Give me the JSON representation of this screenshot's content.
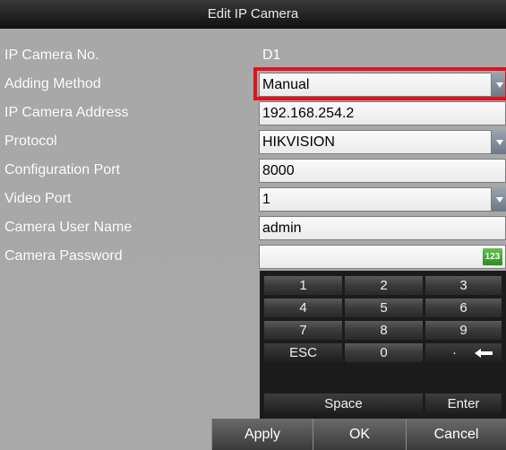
{
  "dialog": {
    "title": "Edit IP Camera"
  },
  "form": {
    "camera_no": {
      "label": "IP Camera No.",
      "value": "D1"
    },
    "adding_method": {
      "label": "Adding Method",
      "value": "Manual"
    },
    "camera_address": {
      "label": "IP Camera Address",
      "value": "192.168.254.2"
    },
    "protocol": {
      "label": "Protocol",
      "value": "HIKVISION"
    },
    "config_port": {
      "label": "Configuration Port",
      "value": "8000"
    },
    "video_port": {
      "label": "Video Port",
      "value": "1"
    },
    "user_name": {
      "label": "Camera User Name",
      "value": "admin"
    },
    "password": {
      "label": "Camera Password",
      "value": "",
      "mode_badge": "123"
    }
  },
  "keypad": {
    "keys": [
      "1",
      "2",
      "3",
      "4",
      "5",
      "6",
      "7",
      "8",
      "9"
    ],
    "esc": "ESC",
    "zero": "0",
    "dot": "·",
    "space": "Space",
    "enter": "Enter"
  },
  "buttons": {
    "apply": "Apply",
    "ok": "OK",
    "cancel": "Cancel"
  },
  "colors": {
    "highlight": "#e3101f",
    "mode_badge": "#3fa52f"
  }
}
